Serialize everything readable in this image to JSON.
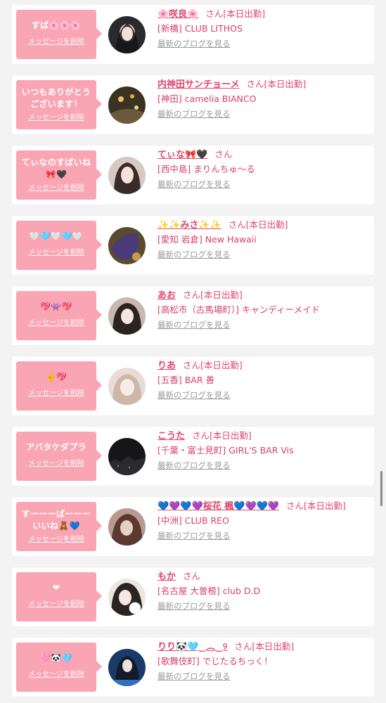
{
  "delete_label": "メッセージを削除",
  "blog_label": "最新のブログを見る",
  "san_label": "さん",
  "cards": [
    {
      "message": "すば🌸🌸🌸",
      "name": "🌸咲良🌸",
      "status": "[本日出勤]",
      "shop": "[新橋] CLUB LITHOS"
    },
    {
      "message": "いつもありがとうございます！",
      "name": "内神田サンチョーメ",
      "status": "[本日出勤]",
      "shop": "[神田] camelia BIANCO"
    },
    {
      "message": "てぃなのすばいね🎀🖤",
      "name": "てぃな🎀🖤",
      "status": "",
      "shop": "[西中島] まりんちゅ〜る"
    },
    {
      "message": "🤍🩵🤍🩵🤍",
      "name": "✨✨みさ✨✨",
      "status": "[本日出勤]",
      "shop": "[愛知 岩倉] New Hawaii"
    },
    {
      "message": "💖👾💖",
      "name": "あお",
      "status": "[本日出勤]",
      "shop": "[高松市（古馬場町）] キャンディーメイド"
    },
    {
      "message": "✌️💖",
      "name": "りあ",
      "status": "[本日出勤]",
      "shop": "[五香] BAR 善"
    },
    {
      "message": "アバタケダプラ",
      "name": "こうた",
      "status": "[本日出勤]",
      "shop": "[千葉・富士見町] GIRL'S BAR Vis"
    },
    {
      "message": "すーーーばーーーいいね🧸💙",
      "name": "💙💜💙💜桜花 楓💙💜💙💜",
      "status": "[本日出勤]",
      "shop": "[中洲] CLUB REO"
    },
    {
      "message": "❤︎",
      "name": "もか",
      "status": "",
      "shop": "[名古屋 大曽根] club D.D"
    },
    {
      "message": "🩷🐼🩵",
      "name": "りり🐼🩵‿︵‿୨",
      "status": "[本日出勤]",
      "shop": "[歌舞伎町] でじたるちっく！"
    }
  ],
  "colors": {
    "accent": "#e0466e",
    "bubble": "#f9a5b3",
    "link_gray": "#9a9a9a"
  }
}
